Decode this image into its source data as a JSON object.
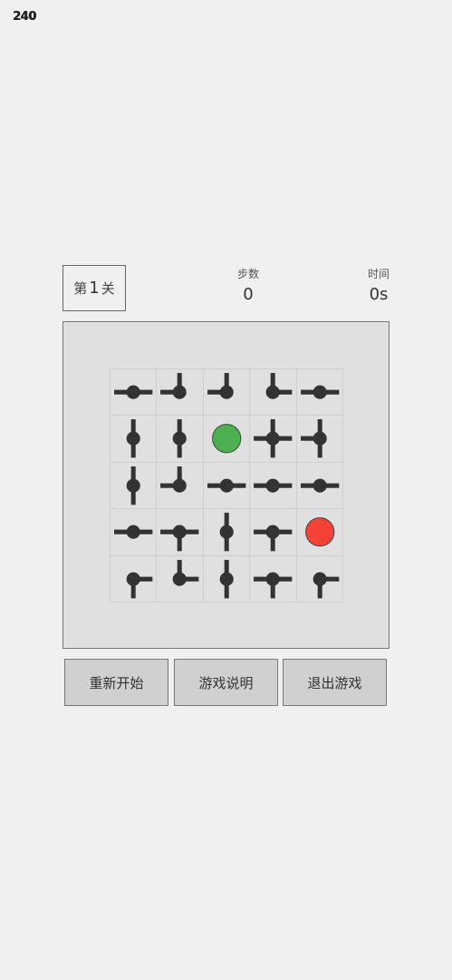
{
  "fps": "240",
  "level": {
    "prefix": "第",
    "number": "1",
    "suffix": "关"
  },
  "stats": {
    "steps_label": "步数",
    "steps_value": "0",
    "time_label": "时间",
    "time_value": "0s"
  },
  "colors": {
    "pipe": "#333333",
    "start": "#4caf50",
    "end": "#f44336"
  },
  "grid": [
    [
      {
        "t": "pipe",
        "c": "ew"
      },
      {
        "t": "pipe",
        "c": "nw"
      },
      {
        "t": "pipe",
        "c": "nw"
      },
      {
        "t": "pipe",
        "c": "ne"
      },
      {
        "t": "pipe",
        "c": "ew"
      }
    ],
    [
      {
        "t": "pipe",
        "c": "ns"
      },
      {
        "t": "pipe",
        "c": "ns"
      },
      {
        "t": "start",
        "c": ""
      },
      {
        "t": "pipe",
        "c": "nesw"
      },
      {
        "t": "pipe",
        "c": "nsw"
      }
    ],
    [
      {
        "t": "pipe",
        "c": "ns"
      },
      {
        "t": "pipe",
        "c": "nw"
      },
      {
        "t": "pipe",
        "c": "ew"
      },
      {
        "t": "pipe",
        "c": "ew"
      },
      {
        "t": "pipe",
        "c": "ew"
      }
    ],
    [
      {
        "t": "pipe",
        "c": "ew"
      },
      {
        "t": "pipe",
        "c": "esw"
      },
      {
        "t": "pipe",
        "c": "ns"
      },
      {
        "t": "pipe",
        "c": "esw"
      },
      {
        "t": "end",
        "c": ""
      }
    ],
    [
      {
        "t": "pipe",
        "c": "es"
      },
      {
        "t": "pipe",
        "c": "ne"
      },
      {
        "t": "pipe",
        "c": "ns"
      },
      {
        "t": "pipe",
        "c": "esw"
      },
      {
        "t": "pipe",
        "c": "es"
      }
    ]
  ],
  "buttons": {
    "restart": "重新开始",
    "help": "游戏说明",
    "exit": "退出游戏"
  }
}
